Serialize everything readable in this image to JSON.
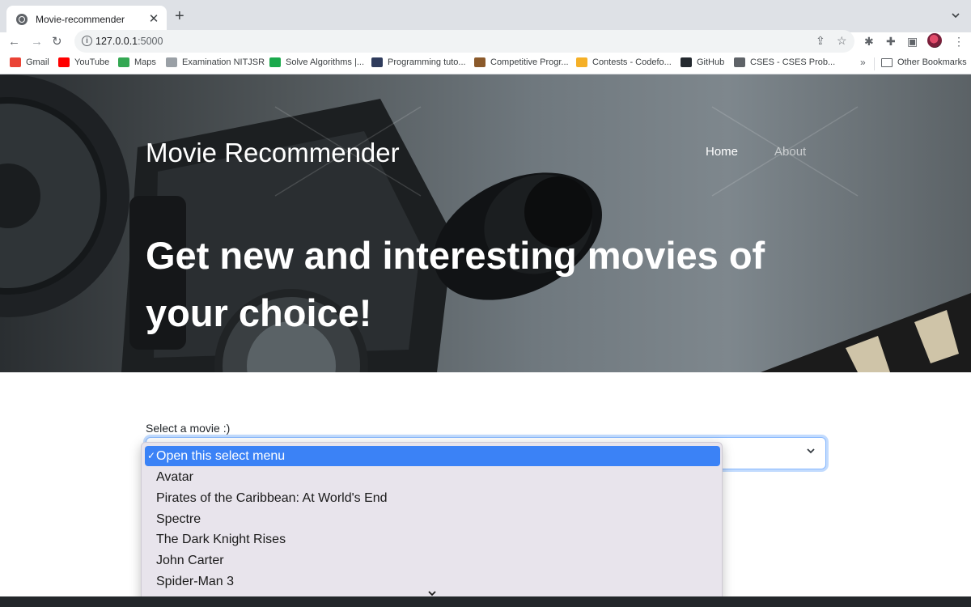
{
  "browser": {
    "tab_title": "Movie-recommender",
    "tab_close": "✕",
    "new_tab": "+",
    "url_host": "127.0.0.1",
    "url_port": ":5000",
    "bookmarks": [
      {
        "label": "Gmail",
        "icon": "gmail-icon",
        "color": "#ea4335"
      },
      {
        "label": "YouTube",
        "icon": "youtube-icon",
        "color": "#ff0000"
      },
      {
        "label": "Maps",
        "icon": "maps-icon",
        "color": "#34a853"
      },
      {
        "label": "Examination NITJSR",
        "icon": "nitjsr-icon",
        "color": "#9aa0a6"
      },
      {
        "label": "Solve Algorithms |...",
        "icon": "hackerrank-icon",
        "color": "#1ba94c"
      },
      {
        "label": "Programming tuto...",
        "icon": "hashnode-icon",
        "color": "#2f3b5c"
      },
      {
        "label": "Competitive Progr...",
        "icon": "codechef-icon",
        "color": "#8b5a2b"
      },
      {
        "label": "Contests - Codefo...",
        "icon": "codeforces-icon",
        "color": "#f5b027"
      },
      {
        "label": "GitHub",
        "icon": "github-icon",
        "color": "#24292f"
      },
      {
        "label": "CSES - CSES Prob...",
        "icon": "globe-icon",
        "color": "#5f6368"
      }
    ],
    "more_bookmarks": "»",
    "other_bookmarks": "Other Bookmarks"
  },
  "page": {
    "brand": "Movie Recommender",
    "nav": [
      {
        "label": "Home"
      },
      {
        "label": "About"
      }
    ],
    "headline": "Get new and interesting movies of your choice!",
    "select_label": "Select a movie :)",
    "select_options": [
      {
        "label": "Open this select menu",
        "selected": true,
        "check": "✓"
      },
      {
        "label": "Avatar"
      },
      {
        "label": "Pirates of the Caribbean: At World's End"
      },
      {
        "label": "Spectre"
      },
      {
        "label": "The Dark Knight Rises"
      },
      {
        "label": "John Carter"
      },
      {
        "label": "Spider-Man 3"
      }
    ]
  },
  "colors": {
    "option_highlight": "#3b82f6",
    "focus_border": "#86b7fe",
    "footer": "#23272a"
  }
}
